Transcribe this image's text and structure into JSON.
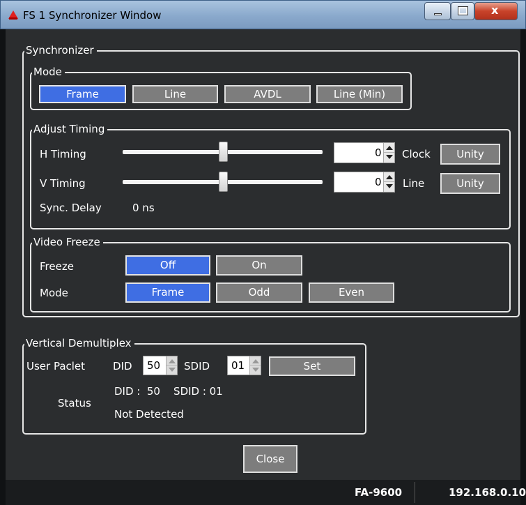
{
  "window": {
    "title": "FS 1 Synchronizer Window"
  },
  "synchronizer": {
    "legend": "Synchronizer",
    "mode": {
      "legend": "Mode",
      "buttons": [
        "Frame",
        "Line",
        "AVDL",
        "Line (Min)"
      ],
      "selected": "Frame"
    },
    "adjust_timing": {
      "legend": "Adjust Timing",
      "h": {
        "label": "H Timing",
        "value": "0",
        "unit": "Clock",
        "unity": "Unity",
        "slider_position": 0.5
      },
      "v": {
        "label": "V Timing",
        "value": "0",
        "unit": "Line",
        "unity": "Unity",
        "slider_position": 0.5
      },
      "sync_delay": {
        "label": "Sync. Delay",
        "value": "0 ns"
      }
    },
    "video_freeze": {
      "legend": "Video Freeze",
      "freeze": {
        "label": "Freeze",
        "options": [
          "Off",
          "On"
        ],
        "selected": "Off"
      },
      "mode": {
        "label": "Mode",
        "options": [
          "Frame",
          "Odd",
          "Even"
        ],
        "selected": "Frame"
      }
    }
  },
  "vertical_demux": {
    "legend": "Vertical Demultiplex",
    "user_paclet": {
      "label": "User Paclet",
      "did_label": "DID",
      "did_value": "50",
      "sdid_label": "SDID",
      "sdid_value": "01",
      "set": "Set"
    },
    "status": {
      "label": "Status",
      "line1": "DID :  50    SDID : 01",
      "line2": "Not Detected"
    }
  },
  "close_label": "Close",
  "footer": {
    "device": "FA-9600",
    "ip": "192.168.0.10"
  },
  "colors": {
    "selected": "#3f6ee3",
    "button": "#7d7d7d",
    "panel": "#2b2d2f"
  }
}
